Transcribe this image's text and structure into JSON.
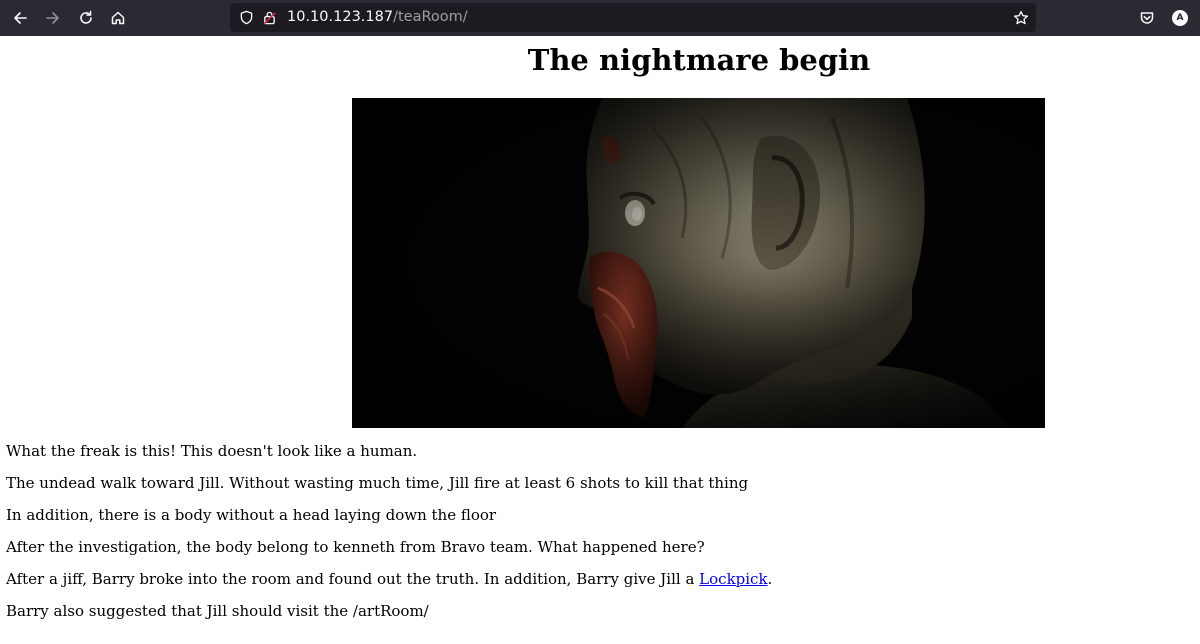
{
  "browser": {
    "url_host": "10.10.123.187",
    "url_path": "/teaRoom/",
    "profile_initial": "A"
  },
  "page": {
    "title": "The nightmare begin",
    "paragraphs": [
      "What the freak is this! This doesn't look like a human.",
      "The undead walk toward Jill. Without wasting much time, Jill fire at least 6 shots to kill that thing",
      "In addition, there is a body without a head laying down the floor",
      "After the investigation, the body belong to kenneth from Bravo team. What happened here?",
      "Barry also suggested that Jill should visit the /artRoom/"
    ],
    "barry_line": {
      "before": "After a jiff, Barry broke into the room and found out the truth. In addition, Barry give Jill a ",
      "link": "Lockpick",
      "after": "."
    }
  }
}
